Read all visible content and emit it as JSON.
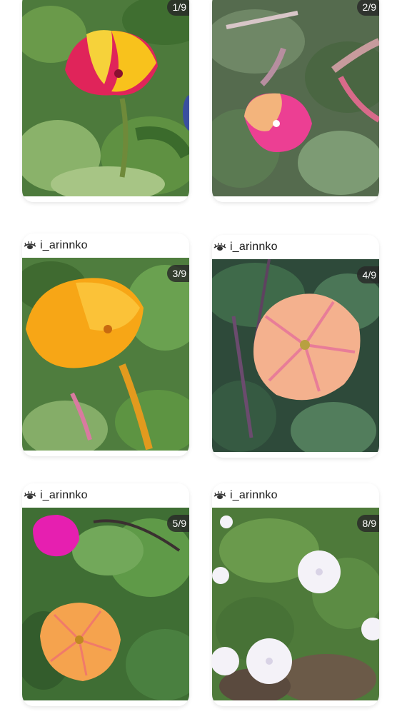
{
  "posts": [
    {
      "username": "",
      "counter": "1/9",
      "flower": "magenta-yellow four o'clock"
    },
    {
      "username": "",
      "counter": "2/9",
      "flower": "peach-pink four o'clock"
    },
    {
      "username": "i_arinnko",
      "counter": "3/9",
      "flower": "orange four o'clock"
    },
    {
      "username": "i_arinnko",
      "counter": "4/9",
      "flower": "peach star four o'clock"
    },
    {
      "username": "i_arinnko",
      "counter": "5/9",
      "flower": "orange and magenta four o'clocks"
    },
    {
      "username": "i_arinnko",
      "counter": "8/9",
      "flower": "white four o'clocks"
    }
  ],
  "icons": {
    "avatar": "eye-lashes-icon"
  },
  "colors": {
    "counter_bg": "#2a2a2a",
    "leaf": "#3f7a35",
    "background": "#ffffff"
  }
}
